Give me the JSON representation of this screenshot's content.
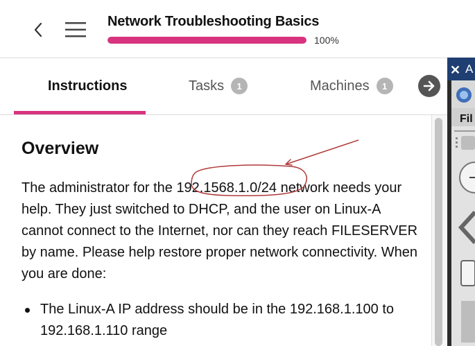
{
  "header": {
    "title": "Network Troubleshooting Basics",
    "progress_fraction": 1.0,
    "progress_label": "100%"
  },
  "tabs": [
    {
      "label": "Instructions",
      "active": true
    },
    {
      "label": "Tasks",
      "badge": "1"
    },
    {
      "label": "Machines",
      "badge": "1"
    }
  ],
  "content": {
    "heading": "Overview",
    "paragraph_before": "The administrator for the ",
    "network_id": "192.1568.1.0/24",
    "paragraph_after": " network needs your help. They just switched to DHCP, and the user on Linux-A cannot connect to the Internet, nor can they reach FILESERVER by name. Please help restore proper network connectivity.  When you are done:",
    "bullets": [
      "The Linux-A IP address should be in the 192.168.1.100 to 192.168.1.110 range"
    ]
  },
  "side_panel": {
    "title_fragment": "A",
    "menu_fragment": "Fil"
  },
  "colors": {
    "accent": "#d8337e",
    "annotation": "#b03a3a",
    "panel_title": "#1f3f73"
  },
  "icons": [
    "back-chevron-icon",
    "hamburger-menu-icon",
    "next-arrow-icon",
    "close-x-icon"
  ]
}
